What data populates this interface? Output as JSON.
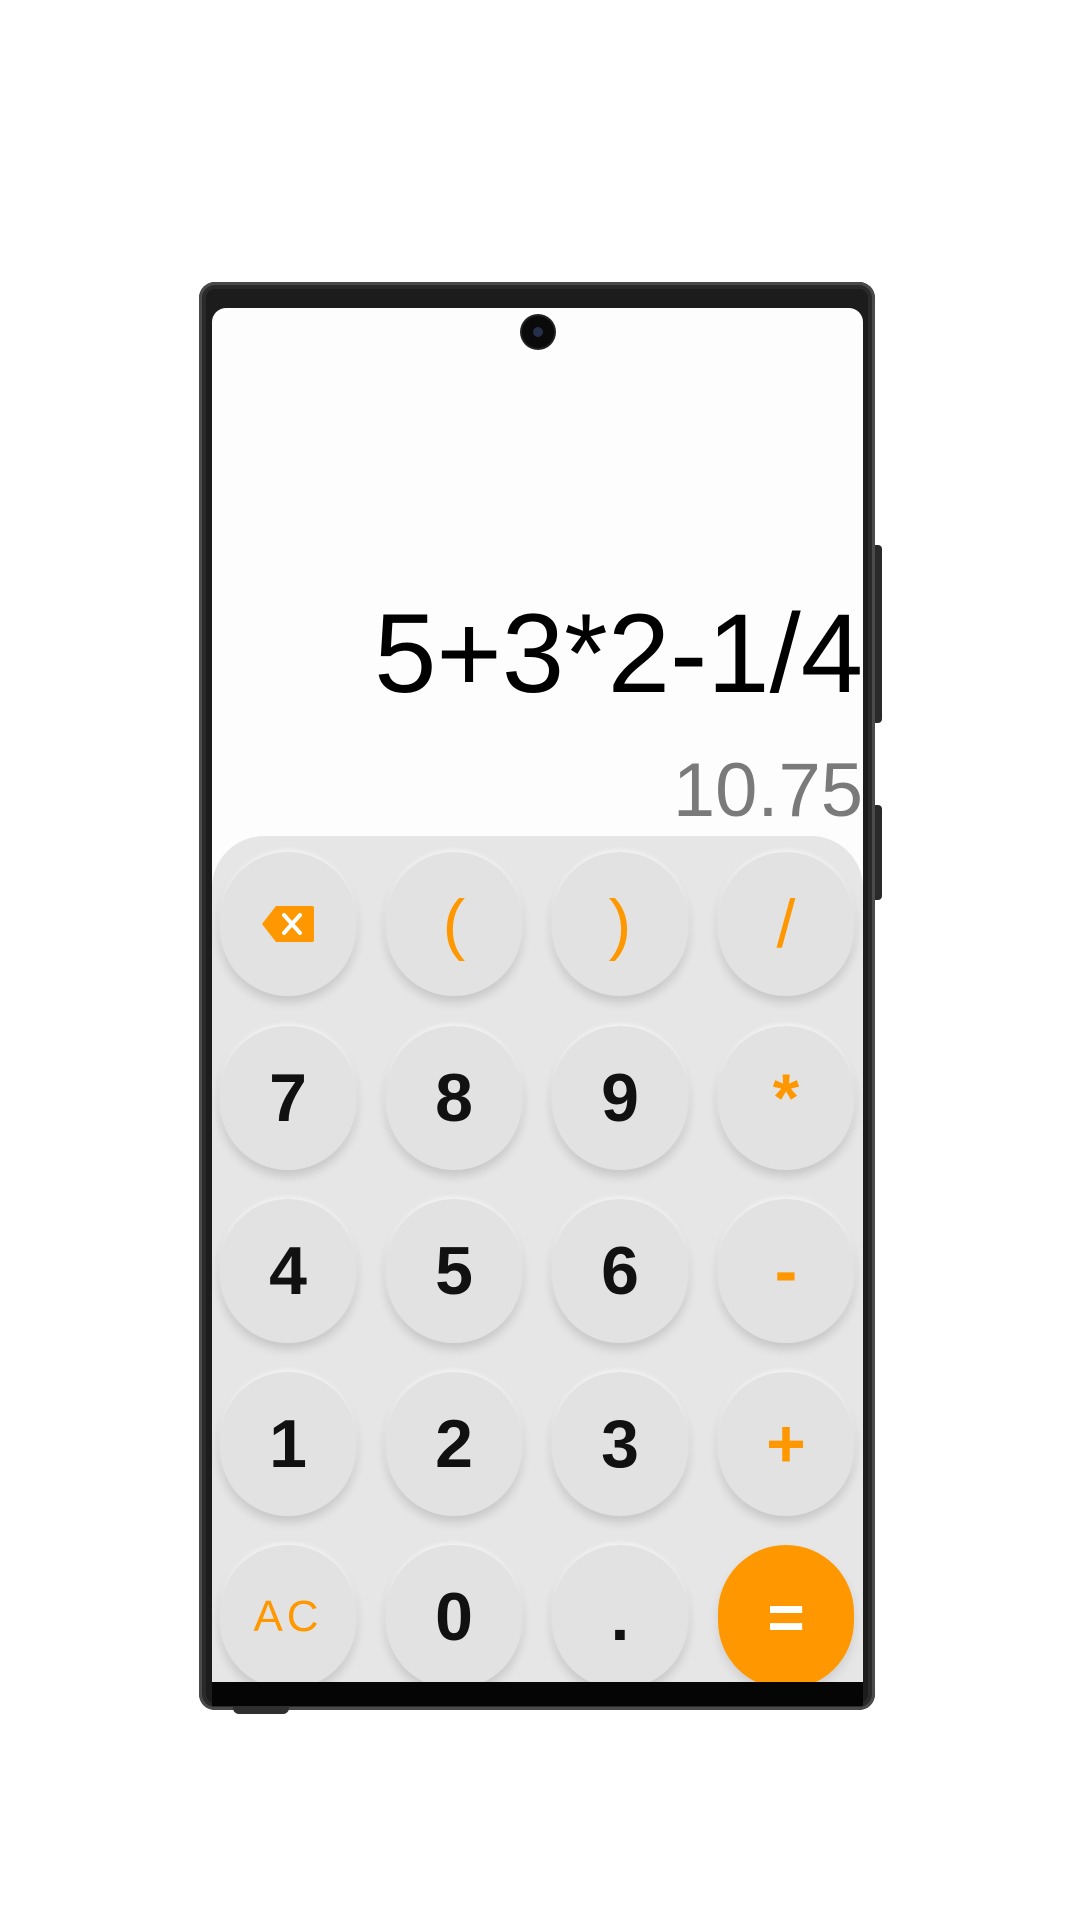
{
  "display": {
    "expression": "5+3*2-1/4",
    "result": "10.75"
  },
  "keypad": {
    "row1": [
      "(",
      ")",
      "/"
    ],
    "row2": [
      "7",
      "8",
      "9",
      "*"
    ],
    "row3": [
      "4",
      "5",
      "6",
      "-"
    ],
    "row4": [
      "1",
      "2",
      "3",
      "+"
    ],
    "row5": [
      "AC",
      "0",
      ".",
      "="
    ],
    "backspace_icon": "backspace-icon"
  },
  "colors": {
    "accent": "#ff9800",
    "key_background": "#e2e2e2",
    "keypad_background": "#e6e6e6",
    "result_text": "#7a7a7a"
  }
}
